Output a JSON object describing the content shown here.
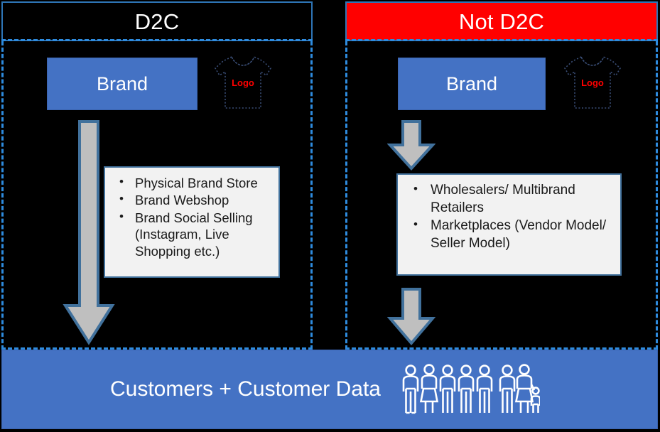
{
  "diagram": {
    "columns": [
      {
        "id": "d2c",
        "title": "D2C",
        "title_bg": "#000000",
        "title_border": "#2E75B6",
        "brand_label": "Brand",
        "logo_label": "Logo",
        "bullets": [
          "Physical Brand Store",
          "Brand Webshop",
          "Brand Social Selling (Instagram, Live Shopping etc.)"
        ]
      },
      {
        "id": "not-d2c",
        "title": "Not D2C",
        "title_bg": "#FF0000",
        "title_border": "#2E75B6",
        "brand_label": "Brand",
        "logo_label": "Logo",
        "bullets": [
          "Wholesalers/ Multibrand Retailers",
          "Marketplaces (Vendor Model/ Seller Model)"
        ]
      }
    ],
    "footer": {
      "label": "Customers + Customer Data",
      "bg": "#4472C4",
      "text_color": "#FFFFFF",
      "people_icon": "people-group-icon",
      "people_count": 8
    },
    "colors": {
      "background": "#000000",
      "brand_blue": "#4472C4",
      "accent_red": "#FF0000",
      "dashed_border": "#2E8BDE",
      "arrow_fill": "#BFBFBF",
      "arrow_border": "#41719C",
      "box_fill": "#F2F2F2",
      "box_border": "#41719C",
      "text_light": "#FFFFFF",
      "text_dark": "#1A1A1A"
    },
    "icons": {
      "shirt": "branded-shirt-icon",
      "arrow": "down-arrow-icon"
    }
  }
}
